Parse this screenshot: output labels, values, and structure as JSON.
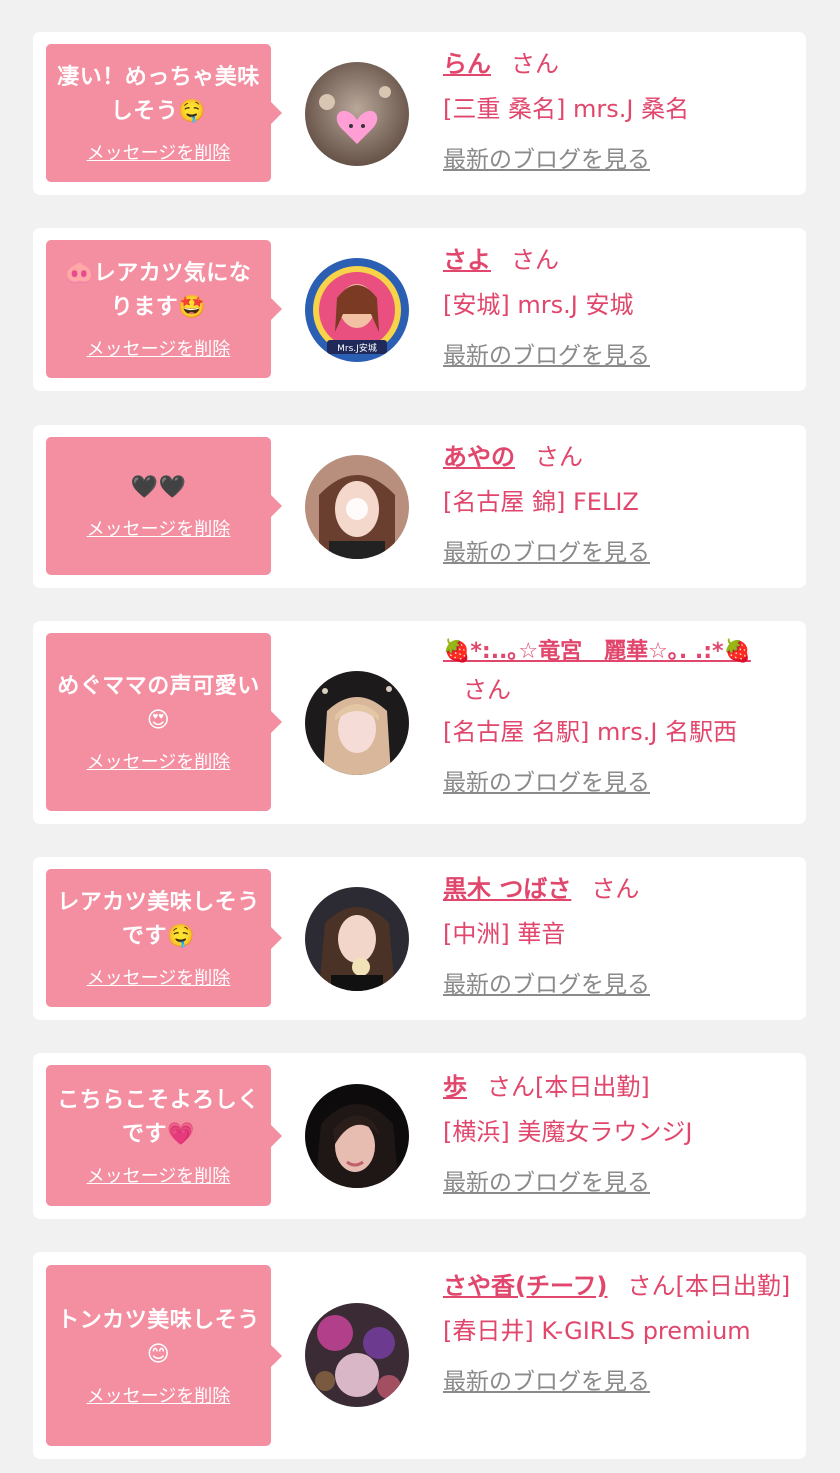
{
  "delete_label": "メッセージを削除",
  "blog_label": "最新のブログを見る",
  "san_label": "さん",
  "colors": {
    "accent": "#e1476c",
    "bubble": "#f48ea1",
    "background": "#f1f1f1"
  },
  "cards": [
    {
      "message": "凄い！めっちゃ美味しそう🤤",
      "name": "らん",
      "suffix": "",
      "shop": "[三重 桑名] mrs.J 桑名"
    },
    {
      "message": "🐽レアカツ気になります🤩",
      "name": "さよ",
      "suffix": "",
      "shop": "[安城] mrs.J 安城",
      "avatar_text": "Mrs.J安城"
    },
    {
      "message": "🖤🖤",
      "name": "あやの",
      "suffix": "",
      "shop": "[名古屋 錦] FELIZ"
    },
    {
      "message": "めぐママの声可愛い😍",
      "name": "🍓*:..｡☆竜宮　麗華☆｡. .:*🍓",
      "suffix": "",
      "shop": "[名古屋 名駅] mrs.J 名駅西"
    },
    {
      "message": "レアカツ美味しそうです🤤",
      "name": "黒木 つばさ",
      "suffix": "",
      "shop": "[中洲] 華音"
    },
    {
      "message": "こちらこそよろしくです💗",
      "name": "歩",
      "suffix": "[本日出勤]",
      "shop": "[横浜] 美魔女ラウンジJ"
    },
    {
      "message": "トンカツ美味しそう😊",
      "name": "さや香(チーフ)",
      "suffix": "[本日出勤]",
      "shop": "[春日井] K-GIRLS premium"
    }
  ]
}
